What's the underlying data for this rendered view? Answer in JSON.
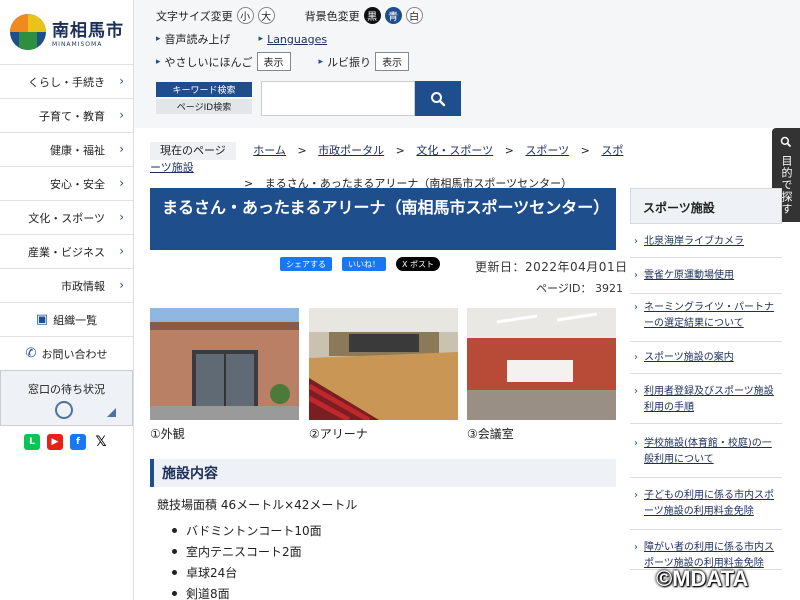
{
  "logo": {
    "city": "南相馬市",
    "roman": "MINAMISOMA"
  },
  "nav": [
    "くらし・手続き",
    "子育て・教育",
    "健康・福祉",
    "安心・安全",
    "文化・スポーツ",
    "産業・ビジネス",
    "市政情報"
  ],
  "nav_extra": {
    "org": "組織一覧",
    "contact": "お問い合わせ"
  },
  "wait": {
    "label": "窓口の待ち状況"
  },
  "social": [
    "LINE",
    "YouTube",
    "Facebook",
    "X"
  ],
  "tools": {
    "font_size": "文字サイズ変更",
    "small": "小",
    "large": "大",
    "bg": "背景色変更",
    "black": "黒",
    "blue": "青",
    "white": "白",
    "readaloud": "音声読み上げ",
    "languages": "Languages",
    "easy_jp": "やさしいにほんご",
    "show": "表示",
    "ruby": "ルビ振り",
    "show2": "表示"
  },
  "search": {
    "tab_keyword": "キーワード検索",
    "tab_pageid": "ページID検索",
    "placeholder": ""
  },
  "find": {
    "label": "目的で探す"
  },
  "breadcrumb": {
    "here": "現在のページ",
    "items": [
      "ホーム",
      "市政ポータル",
      "文化・スポーツ",
      "スポーツ",
      "スポーツ施設"
    ],
    "current": "まるさん・あったまるアリーナ（南相馬市スポーツセンター）"
  },
  "page": {
    "title": "まるさん・あったまるアリーナ（南相馬市スポーツセンター）",
    "share": {
      "fb": "シェアする",
      "like": "いいね！",
      "x": "X ポスト"
    },
    "updated": "更新日：2022年04月01日",
    "page_id": "ページID： 3921",
    "photos": [
      "①外観",
      "②アリーナ",
      "③会議室"
    ],
    "section": "施設内容",
    "area": "競技場面積 46メートル×42メートル",
    "facilities": [
      "バドミントンコート10面",
      "室内テニスコート2面",
      "卓球24台",
      "剣道8面"
    ]
  },
  "sidebar": {
    "heading": "スポーツ施設",
    "items": [
      "北泉海岸ライブカメラ",
      "雲雀ケ原運動場使用",
      "ネーミングライツ・パートナーの選定結果について",
      "スポーツ施設の案内",
      "利用者登録及びスポーツ施設利用の手順",
      "学校施設(体育館・校庭)の一般利用について",
      "子どもの利用に係る市内スポーツ施設の利用料金免除",
      "障がい者の利用に係る市内スポーツ施設の利用料金免除"
    ]
  },
  "watermark": "©MDATA",
  "colors": {
    "brand": "#1f4e8c",
    "header_bg": "#f5f6f8"
  }
}
